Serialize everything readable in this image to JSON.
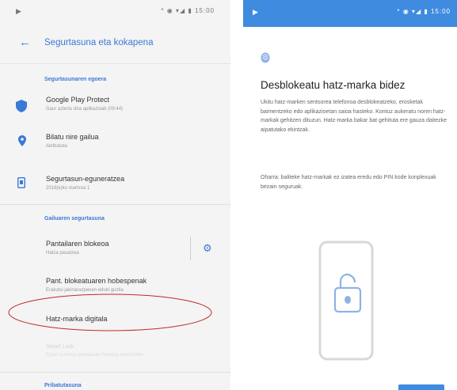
{
  "left": {
    "status_bar": {
      "icons": "* ◉ ▾◢ ▮",
      "time": "15:00"
    },
    "app_bar": {
      "back_icon": "←",
      "title": "Segurtasuna eta kokapena"
    },
    "section_status": "Segurtasunaren egoera",
    "rows_status": [
      {
        "icon": "shield-icon",
        "title": "Google Play Protect",
        "subtitle": "Gaur aztertu dira aplikazioak (09:44)"
      },
      {
        "icon": "location-pin-icon",
        "title": "Bilatu nire gailua",
        "subtitle": "Aktibatuta"
      },
      {
        "icon": "phone-update-icon",
        "title": "Segurtasun-eguneratzea",
        "subtitle": "2018(e)ko martxoa 1"
      }
    ],
    "section_device": "Gailuaren segurtasuna",
    "screen_lock": {
      "title": "Pantailaren blokeoa",
      "subtitle": "Hatza pasatzea"
    },
    "lock_prefs": {
      "title": "Pant. blokeatuaren hobespenak",
      "subtitle": "Erakutsi jakinarazpenen eduki guztia"
    },
    "fingerprint": {
      "title": "Hatz-marka digitala"
    },
    "smart_lock": {
      "title": "Smart Lock",
      "subtitle": "Ezarri aurrena pantailaren blokeoa erabiltzeko"
    },
    "section_bottom": "Pribatutasuna"
  },
  "right": {
    "status_bar": {
      "icons": "* ◉ ▾◢ ▮",
      "time": "15:00"
    },
    "title": "Desblokeatu hatz-marka bidez",
    "body": "Ukitu hatz-marken sentsorea telefonoa desblokeatzeko, erosketak baimentzeko edo aplikazioetan saioa hasteko. Kontuz aukeratu noren hatz-markak gehitzen dituzun. Hatz-marka bakar bat gehituta ere gauza daitezke aipatutako ekintzak.",
    "note": "Oharra: baliteke hatz-markak ez izatea eredu edo PIN kode konplexuak bezain seguruak."
  },
  "colors": {
    "accent": "#3b79d6",
    "status_bar_right": "#3e8be0",
    "annotation": "#c0282d"
  }
}
